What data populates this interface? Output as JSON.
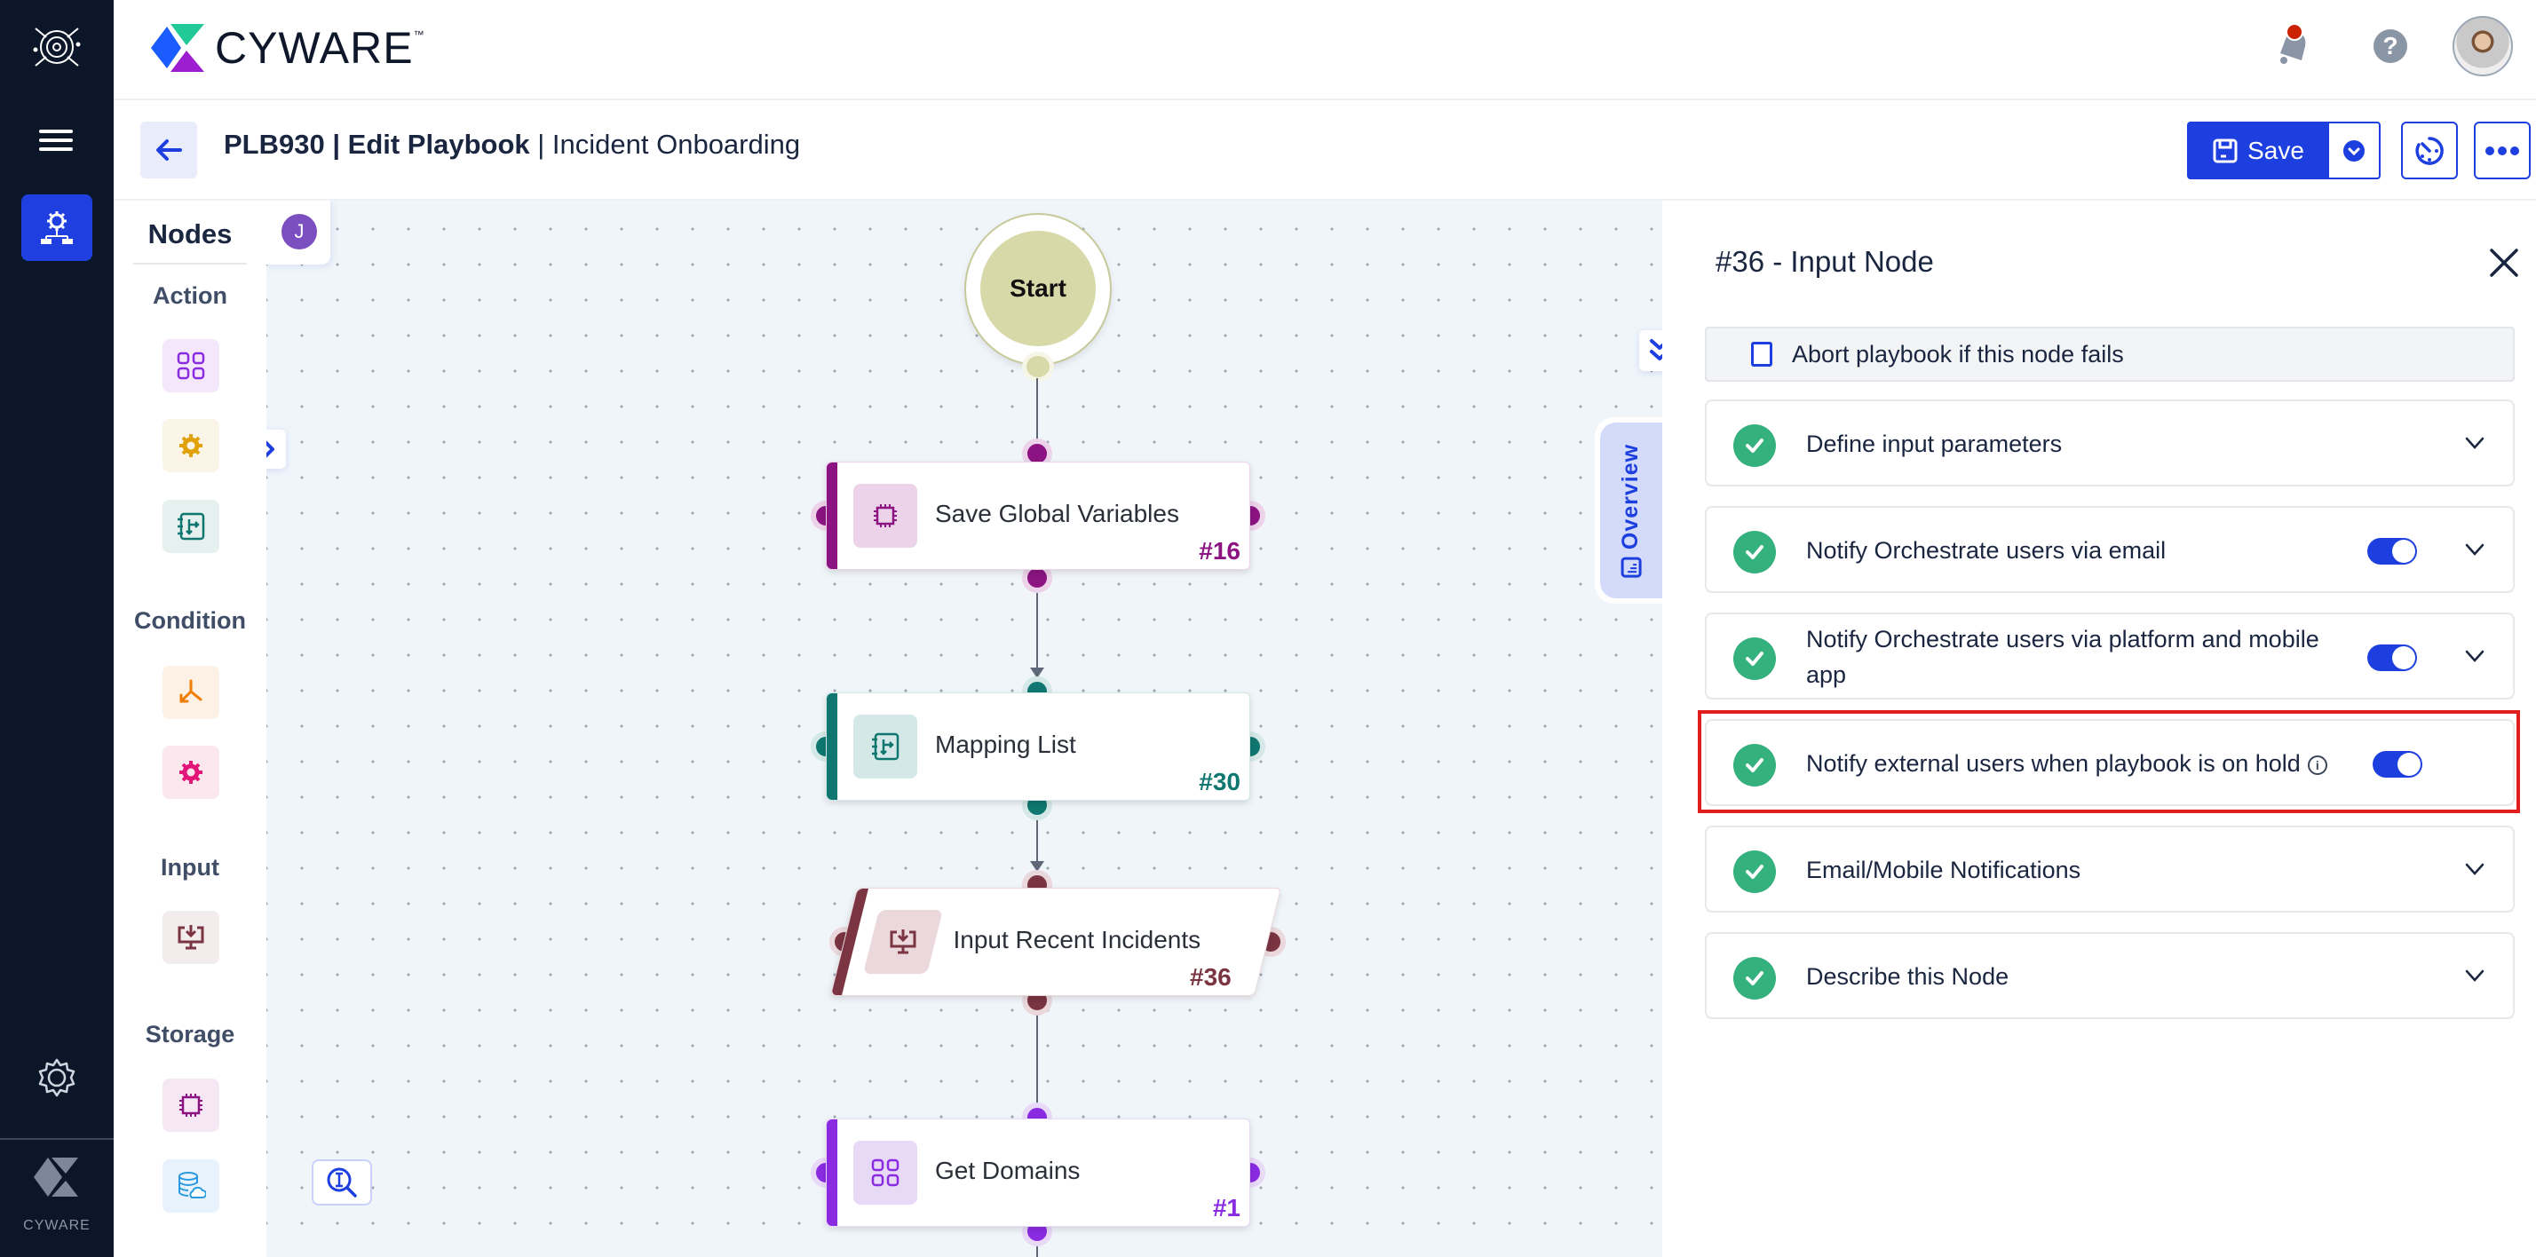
{
  "app": {
    "brand": "CYWARE",
    "brand_tm": "™",
    "rail_brand": "CYWARE"
  },
  "header": {
    "icons": [
      "notification-bell-icon",
      "help-icon",
      "user-avatar"
    ],
    "notification_dot_color": "#cc2200"
  },
  "toolbar": {
    "playbook_id": "PLB930",
    "mode": "Edit Playbook",
    "playbook_name": "Incident Onboarding",
    "separator": " | ",
    "save_label": "Save"
  },
  "nodes_panel": {
    "title": "Nodes",
    "categories": [
      {
        "label": "Action",
        "tiles": [
          "app-action-icon",
          "custom-action-icon",
          "mapping-icon"
        ]
      },
      {
        "label": "Condition",
        "tiles": [
          "condition-split-icon",
          "custom-condition-icon"
        ]
      },
      {
        "label": "Input",
        "tiles": [
          "input-icon"
        ]
      },
      {
        "label": "Storage",
        "tiles": [
          "memory-chip-icon",
          "cloud-database-icon"
        ]
      }
    ]
  },
  "canvas": {
    "user_initial": "J",
    "start_label": "Start",
    "overview_label": "Overview",
    "nodes": [
      {
        "label": "Save Global Variables",
        "number": "#16",
        "color": "#8b1482",
        "tint": "#ecd3ea",
        "type": "storage"
      },
      {
        "label": "Mapping List",
        "number": "#30",
        "color": "#0f7770",
        "tint": "#d3e8e7",
        "type": "mapping"
      },
      {
        "label": "Input Recent Incidents",
        "number": "#36",
        "color": "#7a3442",
        "tint": "#ead8dc",
        "type": "input"
      },
      {
        "label": "Get Domains",
        "number": "#1",
        "color": "#8a2be2",
        "tint": "#e8d9f7",
        "type": "action"
      }
    ]
  },
  "panel": {
    "title": "#36 - Input Node",
    "abort_label": "Abort playbook if this node fails",
    "abort_checked": false,
    "sections": [
      {
        "label": "Define input parameters",
        "complete": true,
        "toggle": null,
        "expandable": true
      },
      {
        "label": "Notify Orchestrate users via email",
        "complete": true,
        "toggle": true,
        "expandable": true
      },
      {
        "label": "Notify Orchestrate users via platform and mobile app",
        "complete": true,
        "toggle": true,
        "expandable": true
      },
      {
        "label": "Notify external users when playbook is on hold",
        "complete": true,
        "toggle": true,
        "expandable": false,
        "info": true,
        "highlighted": true
      },
      {
        "label": "Email/Mobile Notifications",
        "complete": true,
        "toggle": null,
        "expandable": true
      },
      {
        "label": "Describe this Node",
        "complete": true,
        "toggle": null,
        "expandable": true
      }
    ]
  },
  "colors": {
    "accent": "#1d3fe0",
    "success": "#35b17e",
    "rail_bg": "#0b1729",
    "highlight": "#e11d1d"
  }
}
